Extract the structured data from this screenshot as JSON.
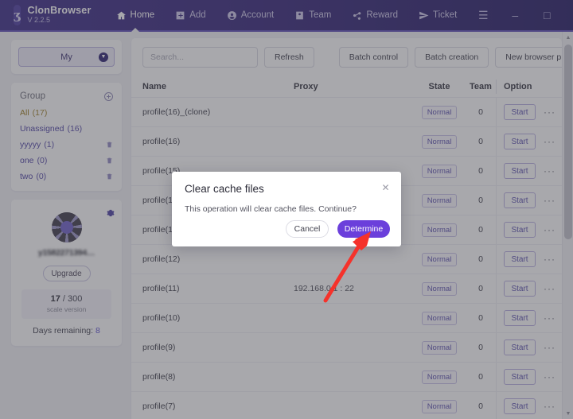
{
  "titlebar": {
    "logo_glyph": "ʒ",
    "brand_name": "ClonBrowser",
    "version": "V 2.2.5",
    "nav": [
      {
        "label": "Home",
        "icon": "home-icon",
        "active": true
      },
      {
        "label": "Add",
        "icon": "plus-square-icon",
        "active": false
      },
      {
        "label": "Account",
        "icon": "user-circle-icon",
        "active": false
      },
      {
        "label": "Team",
        "icon": "id-card-icon",
        "active": false
      },
      {
        "label": "Reward",
        "icon": "share-icon",
        "active": false
      },
      {
        "label": "Ticket",
        "icon": "send-icon",
        "active": false
      }
    ],
    "window_controls": [
      {
        "name": "menu-button",
        "glyph": "☰"
      },
      {
        "name": "minimize-button",
        "glyph": "–"
      },
      {
        "name": "maximize-button",
        "glyph": "□"
      },
      {
        "name": "close-button",
        "glyph": "✕"
      }
    ]
  },
  "sidebar": {
    "my_selector": {
      "label": "My",
      "caret": "▼"
    },
    "group": {
      "title": "Group",
      "add_icon": "plus-circle-icon",
      "items": [
        {
          "name": "All",
          "count": "(17)",
          "deletable": false
        },
        {
          "name": "Unassigned",
          "count": "(16)",
          "deletable": false
        },
        {
          "name": "yyyyy",
          "count": "(1)",
          "deletable": true
        },
        {
          "name": "one",
          "count": "(0)",
          "deletable": true
        },
        {
          "name": "two",
          "count": "(0)",
          "deletable": true
        }
      ]
    },
    "user": {
      "settings_icon": "gear-icon",
      "avatar": "user-avatar",
      "username": "y1582271394…",
      "upgrade_label": "Upgrade",
      "quota_used": "17",
      "quota_sep": "/ 300",
      "quota_caption": "scale version",
      "days_label": "Days remaining:",
      "days_value": "8"
    }
  },
  "main": {
    "toolbar": {
      "search_placeholder": "Search...",
      "search_value": "",
      "refresh_label": "Refresh",
      "batch_control_label": "Batch control",
      "batch_creation_label": "Batch creation",
      "new_profile_label": "New browser profile"
    },
    "table": {
      "headers": {
        "name": "Name",
        "proxy": "Proxy",
        "state": "State",
        "team": "Team",
        "option": "Option"
      },
      "start_label": "Start",
      "more_glyph": "···",
      "rows": [
        {
          "name": "profile(16)_(clone)",
          "proxy": "",
          "state": "Normal",
          "team": "0"
        },
        {
          "name": "profile(16)",
          "proxy": "",
          "state": "Normal",
          "team": "0"
        },
        {
          "name": "profile(15)",
          "proxy": "",
          "state": "Normal",
          "team": "0"
        },
        {
          "name": "profile(14)",
          "proxy": "",
          "state": "Normal",
          "team": "0"
        },
        {
          "name": "profile(13)",
          "proxy": "",
          "state": "Normal",
          "team": "0"
        },
        {
          "name": "profile(12)",
          "proxy": "",
          "state": "Normal",
          "team": "0"
        },
        {
          "name": "profile(11)",
          "proxy": "192.168.0.1 : 22",
          "state": "Normal",
          "team": "0"
        },
        {
          "name": "profile(10)",
          "proxy": "",
          "state": "Normal",
          "team": "0"
        },
        {
          "name": "profile(9)",
          "proxy": "",
          "state": "Normal",
          "team": "0"
        },
        {
          "name": "profile(8)",
          "proxy": "",
          "state": "Normal",
          "team": "0"
        },
        {
          "name": "profile(7)",
          "proxy": "",
          "state": "Normal",
          "team": "0"
        }
      ]
    },
    "scrollbar": {
      "up_glyph": "▲",
      "down_glyph": "▼"
    }
  },
  "modal": {
    "title": "Clear cache files",
    "close_glyph": "✕",
    "message": "This operation will clear cache files. Continue?",
    "cancel_label": "Cancel",
    "determine_label": "Determine"
  },
  "colors": {
    "titlebar_start": "#3a2a86",
    "titlebar_end": "#231a63",
    "accent_purple": "#6b3fdb",
    "badge_purple": "#5a4fae",
    "group_all": "#9a7b1e",
    "group_link": "#4b3fa3",
    "annotation_red": "#f5322b"
  }
}
